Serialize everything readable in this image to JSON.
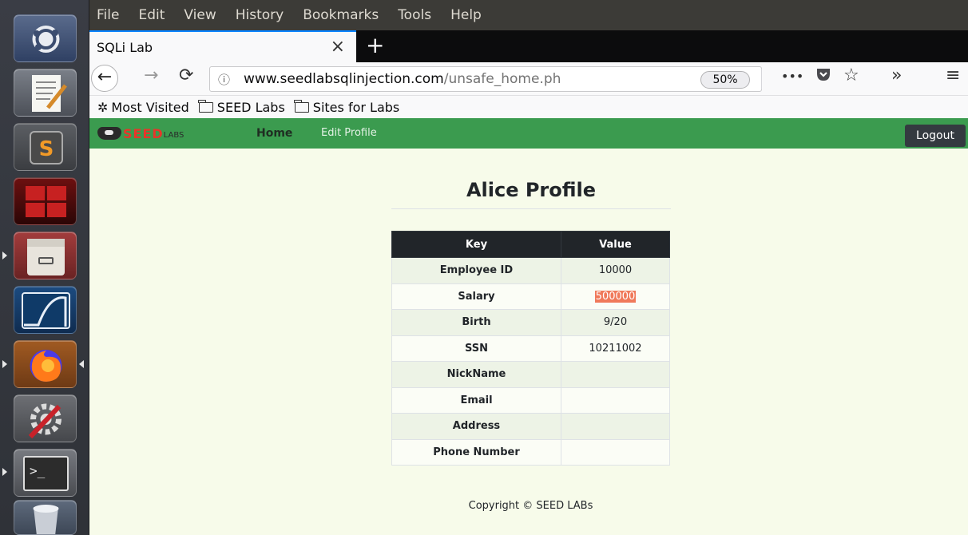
{
  "launcher": {
    "apps": [
      {
        "name": "ubuntu-dash-icon"
      },
      {
        "name": "text-editor-icon"
      },
      {
        "name": "sublime-text-icon"
      },
      {
        "name": "terminal-multiplexer-icon"
      },
      {
        "name": "file-manager-icon"
      },
      {
        "name": "wireshark-icon"
      },
      {
        "name": "firefox-icon"
      },
      {
        "name": "system-settings-icon"
      },
      {
        "name": "terminal-icon"
      },
      {
        "name": "trash-icon"
      }
    ]
  },
  "browser": {
    "menu": [
      "File",
      "Edit",
      "View",
      "History",
      "Bookmarks",
      "Tools",
      "Help"
    ],
    "tab_title": "SQLi Lab",
    "url_host": "www.seedlabsqlinjection.com",
    "url_path": "/unsafe_home.ph",
    "zoom": "50%",
    "bookmarks": [
      "Most Visited",
      "SEED Labs",
      "Sites for Labs"
    ]
  },
  "site": {
    "logo_text": "SEED",
    "logo_sub": "LABS",
    "nav_home": "Home",
    "nav_edit": "Edit Profile",
    "logout": "Logout",
    "profile_title": "Alice Profile",
    "table": {
      "headers": [
        "Key",
        "Value"
      ],
      "rows": [
        {
          "key": "Employee ID",
          "value": "10000"
        },
        {
          "key": "Salary",
          "value": "500000"
        },
        {
          "key": "Birth",
          "value": "9/20"
        },
        {
          "key": "SSN",
          "value": "10211002"
        },
        {
          "key": "NickName",
          "value": ""
        },
        {
          "key": "Email",
          "value": ""
        },
        {
          "key": "Address",
          "value": ""
        },
        {
          "key": "Phone Number",
          "value": ""
        }
      ]
    },
    "copyright": "Copyright © SEED LABs"
  },
  "colors": {
    "nav_green": "#3b9b4f",
    "page_bg": "#f7fbea",
    "table_header": "#212529",
    "selection_highlight": "#f0795a"
  }
}
